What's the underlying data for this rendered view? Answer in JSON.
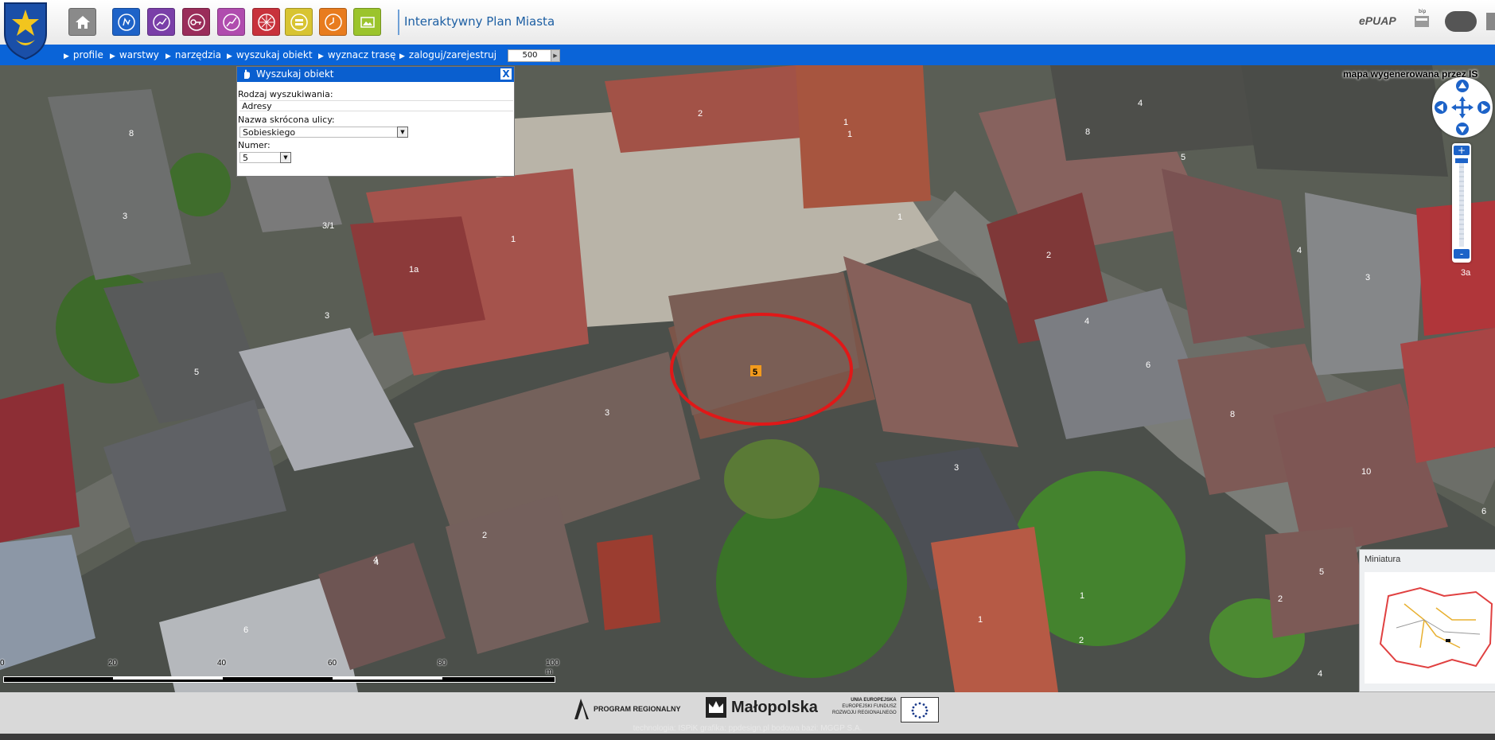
{
  "header": {
    "app_title": "Interaktywny Plan Miasta",
    "toolbar_icons": [
      "home-icon",
      "profile-icon",
      "chart-icon",
      "key-icon",
      "route-icon",
      "grid-icon",
      "layers-icon",
      "clock-icon",
      "image-icon"
    ],
    "toolbar_colors": [
      "#8a8a8a",
      "#1e63c8",
      "#7a3fa8",
      "#9a2d5a",
      "#b04cae",
      "#c8323c",
      "#d8c432",
      "#e87c1e",
      "#9bc42c"
    ],
    "logos": {
      "epuap": "ePUAP",
      "bip": "bip"
    }
  },
  "nav": {
    "items": [
      "profile",
      "warstwy",
      "narzędzia",
      "wyszukaj obiekt",
      "wyznacz trasę",
      "zaloguj/zarejestruj"
    ],
    "scale_value": "500"
  },
  "search_panel": {
    "title": "Wyszukaj obiekt",
    "close_label": "X",
    "search_type_label": "Rodzaj wyszukiwania:",
    "search_type_value": "Adresy",
    "street_label": "Nazwa skrócona ulicy:",
    "street_value": "Sobieskiego",
    "number_label": "Numer:",
    "number_value": "5"
  },
  "map": {
    "note": "mapa wygenerowana przez IS",
    "highlight_label": "5",
    "highlight_color": "#e01818",
    "building_numbers": [
      "8",
      "1",
      "2",
      "1",
      "4",
      "8",
      "5",
      "6",
      "3",
      "3/1",
      "1",
      "1a",
      "3",
      "5",
      "4",
      "2",
      "6",
      "3",
      "1",
      "4",
      "2",
      "4",
      "6",
      "3",
      "3a",
      "8",
      "10",
      "6",
      "5",
      "2",
      "4",
      "1",
      "2",
      "4",
      "1",
      "3"
    ]
  },
  "scalebar": {
    "labels": [
      "0",
      "20",
      "40",
      "60",
      "80",
      "100 m"
    ]
  },
  "minimap": {
    "title": "Miniatura"
  },
  "footer": {
    "program_regionalny": "PROGRAM REGIONALNY",
    "malopolska": "Małopolska",
    "ue_line1": "UNIA EUROPEJSKA",
    "ue_line2": "EUROPEJSKI FUNDUSZ",
    "ue_line3": "ROZWOJU REGIONALNEGO",
    "credits": "technologia: ISPiK grafika: ppdesign.pl bodowa bazi: MGGP S.A."
  }
}
